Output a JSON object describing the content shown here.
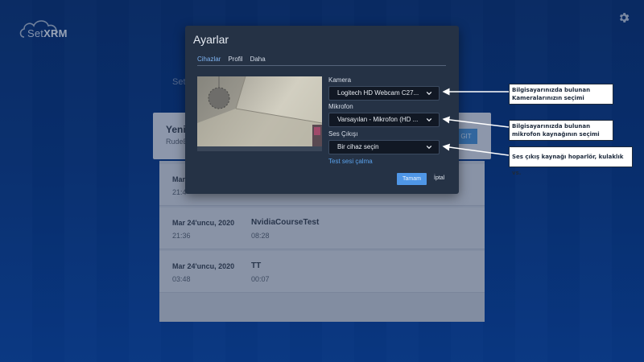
{
  "app": {
    "logo_text_a": "Set",
    "logo_text_b": "XRM"
  },
  "background": {
    "label": "Set",
    "card": {
      "title": "Yeni",
      "subtitle": "RudeE",
      "button": "GIT"
    },
    "rows": [
      {
        "date": "Mar",
        "time": "21:4",
        "name": "",
        "duration": ""
      },
      {
        "date": "Mar 24'uncu, 2020",
        "time": "21:36",
        "name": "NvidiaCourseTest",
        "duration": "08:28"
      },
      {
        "date": "Mar 24'uncu, 2020",
        "time": "03:48",
        "name": "TT",
        "duration": "00:07"
      }
    ]
  },
  "modal": {
    "title": "Ayarlar",
    "tabs": [
      {
        "label": "Cihazlar",
        "active": true
      },
      {
        "label": "Profil",
        "active": false
      },
      {
        "label": "Daha",
        "active": false
      }
    ],
    "camera_label": "Kamera",
    "camera_value": "Logitech HD Webcam C27...",
    "mic_label": "Mikrofon",
    "mic_value": "Varsayılan - Mikrofon (HD ...",
    "speaker_label": "Ses Çıkışı",
    "speaker_value": "Bir cihaz seçin",
    "test_link": "Test sesi çalma",
    "ok_button": "Tamam",
    "cancel_button": "İptal"
  },
  "callouts": {
    "camera": "Bilgisayarınızda bulunan Kameralarınızın seçimi",
    "mic": "Bilgisayarınızda bulunan mikrofon kaynağının seçimi",
    "speaker": "Ses çıkış kaynağı hoparlör, kulaklık vs."
  },
  "colors": {
    "accent": "#4f96e6",
    "modal_bg": "#253245",
    "select_bg": "#111824"
  }
}
